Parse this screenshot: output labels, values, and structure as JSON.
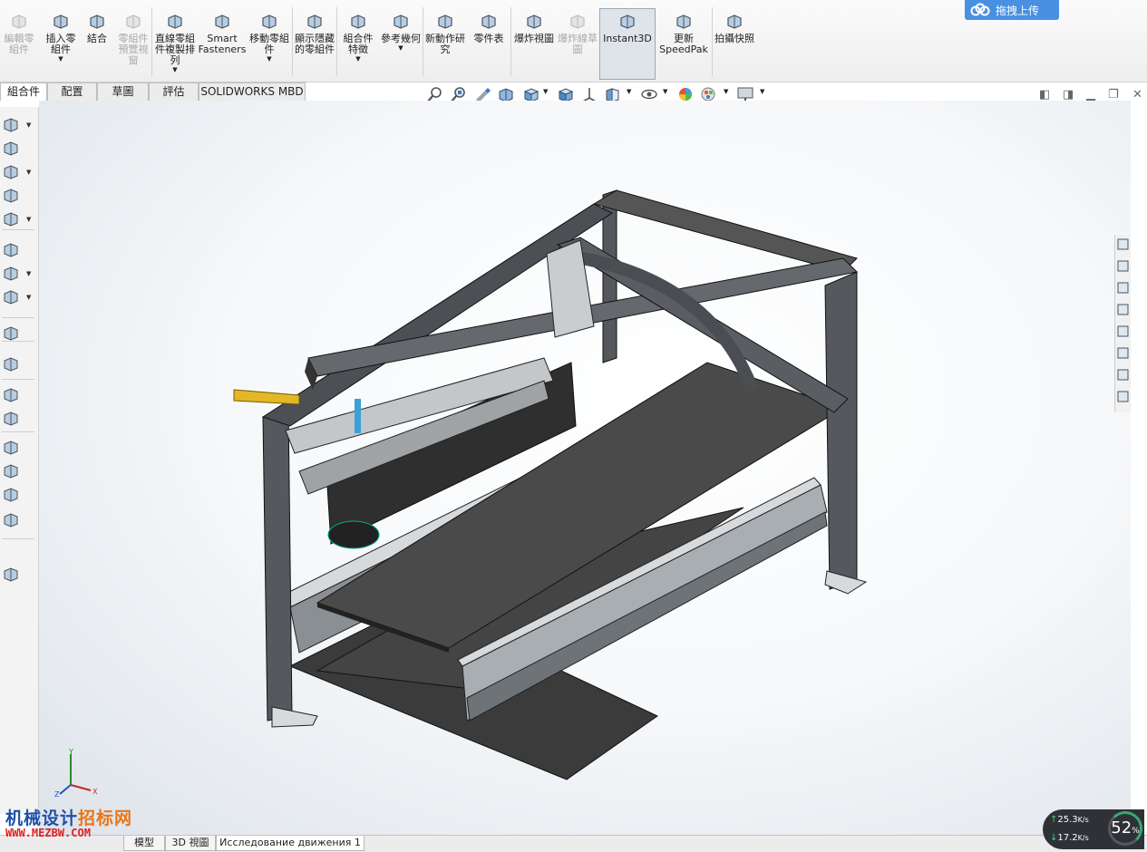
{
  "ribbon": {
    "buttons": [
      {
        "name": "edit-component",
        "label": "編輯零組件",
        "icon": "edit-component-icon",
        "disabled": true,
        "caret": false
      },
      {
        "name": "insert-components",
        "label": "插入零組件",
        "icon": "insert-component-icon",
        "disabled": false,
        "caret": true
      },
      {
        "name": "mate",
        "label": "結合",
        "icon": "paperclip-mate-icon",
        "disabled": false,
        "caret": false
      },
      {
        "name": "component-preview-window",
        "label": "零組件預覽視窗",
        "icon": "preview-window-icon",
        "disabled": true,
        "caret": false
      },
      {
        "name": "linear-component-pattern",
        "label": "直線零組件複製排列",
        "icon": "pattern-icon",
        "disabled": false,
        "caret": true
      },
      {
        "name": "smart-fasteners",
        "label": "Smart Fasteners",
        "icon": "fastener-icon",
        "disabled": false,
        "caret": false
      },
      {
        "name": "move-component",
        "label": "移動零組件",
        "icon": "move-component-icon",
        "disabled": false,
        "caret": true
      },
      {
        "name": "show-hidden-components",
        "label": "顯示隱藏的零組件",
        "icon": "show-hidden-icon",
        "disabled": false,
        "caret": false
      },
      {
        "name": "assembly-features",
        "label": "組合件特徵",
        "icon": "assembly-feature-icon",
        "disabled": false,
        "caret": true
      },
      {
        "name": "reference-geometry",
        "label": "參考幾何",
        "icon": "reference-geometry-icon",
        "disabled": false,
        "caret": true
      },
      {
        "name": "new-motion-study",
        "label": "新動作研究",
        "icon": "motion-study-icon",
        "disabled": false,
        "caret": false
      },
      {
        "name": "bill-of-materials",
        "label": "零件表",
        "icon": "bom-icon",
        "disabled": false,
        "caret": false
      },
      {
        "name": "exploded-view",
        "label": "爆炸視圖",
        "icon": "exploded-view-icon",
        "disabled": false,
        "caret": false
      },
      {
        "name": "explode-line-sketch",
        "label": "爆炸線草圖",
        "icon": "explode-line-icon",
        "disabled": true,
        "caret": false
      },
      {
        "name": "instant3d",
        "label": "Instant3D",
        "icon": "instant3d-icon",
        "disabled": false,
        "caret": false,
        "active": true
      },
      {
        "name": "update-speedpak",
        "label": "更新SpeedPak",
        "icon": "speedpak-icon",
        "disabled": false,
        "caret": false
      },
      {
        "name": "take-snapshot",
        "label": "拍攝快照",
        "icon": "camera-icon",
        "disabled": false,
        "caret": false
      }
    ]
  },
  "cloud_upload": {
    "label": "拖拽上传",
    "icon": "cloud-icon"
  },
  "command_tabs": [
    "組合件",
    "配置",
    "草圖",
    "評估",
    "SOLIDWORKS MBD"
  ],
  "view_toolbar_icons": [
    "zoom-to-fit-icon",
    "zoom-to-area-icon",
    "previous-view-icon",
    "section-view-icon",
    "view-orientation-icon",
    "display-style-icon",
    "hide-show-icon",
    "edit-appearance-icon",
    "apply-scene-icon",
    "view-settings-icon"
  ],
  "left_toolbar_icons": [
    "insert-component-icon",
    "mate-icon",
    "pattern-icon",
    "move-component-icon",
    "show-hidden-icon",
    "assembly-feature-icon",
    "reference-geometry-icon",
    "motion-study-icon",
    "bom-icon",
    "exploded-view-icon",
    "explode-line-icon",
    "sketch-icon",
    "layout-icon",
    "speedpak-icon",
    "snapshot-icon",
    "appearance-icon",
    "instant3d-icon"
  ],
  "task_pane_icons": [
    "home-icon",
    "parts-icon",
    "folder-icon",
    "view-palette-icon",
    "appearances-icon",
    "properties-icon",
    "forum-icon",
    "help-icon"
  ],
  "bottom_tabs": [
    "模型",
    "3D 視圖",
    "Исследование движения 1"
  ],
  "watermark": {
    "line1_a": "机械设计",
    "line1_b": "招标网",
    "line2": "WWW.MEZBW.COM"
  },
  "network": {
    "up": "25.3",
    "down": "17.2",
    "unit": "K/s",
    "percent": "52",
    "percent_unit": "%"
  },
  "triad": {
    "x": "X",
    "y": "Y",
    "z": "Z"
  }
}
